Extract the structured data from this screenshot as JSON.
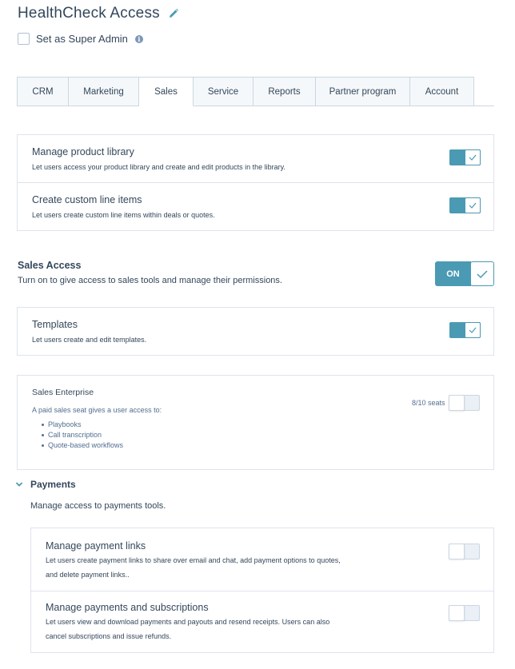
{
  "page": {
    "title": "HealthCheck Access",
    "super_admin_label": "Set as Super Admin"
  },
  "tabs": [
    {
      "label": "CRM",
      "active": false
    },
    {
      "label": "Marketing",
      "active": false
    },
    {
      "label": "Sales",
      "active": true
    },
    {
      "label": "Service",
      "active": false
    },
    {
      "label": "Reports",
      "active": false
    },
    {
      "label": "Partner program",
      "active": false
    },
    {
      "label": "Account",
      "active": false
    }
  ],
  "product_permissions": [
    {
      "title": "Manage product library",
      "description": "Let users access your product library and create and edit products in the library.",
      "enabled": true
    },
    {
      "title": "Create custom line items",
      "description": "Let users create custom line items within deals or quotes.",
      "enabled": true
    }
  ],
  "sales_access": {
    "title": "Sales Access",
    "description": "Turn on to give access to sales tools and manage their permissions.",
    "toggle_label": "ON",
    "enabled": true
  },
  "templates": {
    "title": "Templates",
    "description": "Let users create and edit templates.",
    "enabled": true
  },
  "sales_enterprise": {
    "title": "Sales Enterprise",
    "description": "A paid sales seat gives a user access to:",
    "features": [
      "Playbooks",
      "Call transcription",
      "Quote-based workflows"
    ],
    "seats": "8/10 seats",
    "enabled": false
  },
  "payments": {
    "title": "Payments",
    "description": "Manage access to payments tools.",
    "items": [
      {
        "title": "Manage payment links",
        "description_line1": "Let users create payment links to share over email and chat, add payment options to quotes,",
        "description_line2": "and delete payment links..",
        "enabled": false
      },
      {
        "title": "Manage payments and subscriptions",
        "description_line1": "Let users view and download payments and payouts and resend receipts. Users can also",
        "description_line2": "cancel subscriptions and issue refunds.",
        "enabled": false
      }
    ]
  },
  "colors": {
    "accent": "#4b9ab3",
    "text": "#33475b",
    "border": "#dfe3eb",
    "tab_bg": "#f5f8fa"
  }
}
